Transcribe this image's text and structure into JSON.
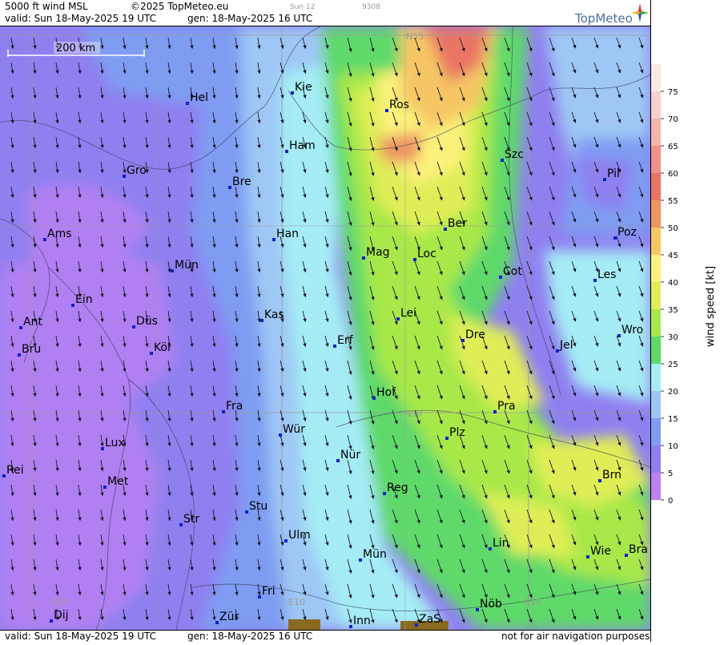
{
  "header": {
    "product": "5000 ft wind MSL",
    "copyright": "©2025 TopMeteo.eu",
    "valid": "valid:  Sun  18-May-2025  19 UTC",
    "gen": "gen: 18-May-2025 16 UTC",
    "run_tag": "Sun 12",
    "run_code": "9308",
    "logo_text": "TopMeteo"
  },
  "footer": {
    "valid": "valid:  Sun  18-May-2025  19 UTC",
    "gen": "gen: 18-May-2025 16 UTC",
    "disclaimer": "not for air navigation purposes"
  },
  "map": {
    "scale_label": "200 km",
    "grid_labels": [
      "N55",
      "N50",
      "E05",
      "E10",
      "E15"
    ],
    "cities": [
      {
        "name": "Kie"
      },
      {
        "name": "Hel"
      },
      {
        "name": "Ros"
      },
      {
        "name": "Ham"
      },
      {
        "name": "Gro"
      },
      {
        "name": "Bre"
      },
      {
        "name": "Szc"
      },
      {
        "name": "Pil"
      },
      {
        "name": "Ber"
      },
      {
        "name": "Ams"
      },
      {
        "name": "Han"
      },
      {
        "name": "Poz"
      },
      {
        "name": "Mag"
      },
      {
        "name": "Loc"
      },
      {
        "name": "Mün"
      },
      {
        "name": "Cot"
      },
      {
        "name": "Les"
      },
      {
        "name": "Ein"
      },
      {
        "name": "Kas"
      },
      {
        "name": "Lei"
      },
      {
        "name": "Ant"
      },
      {
        "name": "Düs"
      },
      {
        "name": "Wro"
      },
      {
        "name": "Dre"
      },
      {
        "name": "Erf"
      },
      {
        "name": "Bru"
      },
      {
        "name": "Köl"
      },
      {
        "name": "Jel"
      },
      {
        "name": "Hof"
      },
      {
        "name": "Fra"
      },
      {
        "name": "Pra"
      },
      {
        "name": "Wür"
      },
      {
        "name": "Plz"
      },
      {
        "name": "Lux"
      },
      {
        "name": "Nür"
      },
      {
        "name": "Rei"
      },
      {
        "name": "Brn"
      },
      {
        "name": "Met"
      },
      {
        "name": "Reg"
      },
      {
        "name": "Stu"
      },
      {
        "name": "Str"
      },
      {
        "name": "Ulm"
      },
      {
        "name": "Lin"
      },
      {
        "name": "Wie"
      },
      {
        "name": "Bra"
      },
      {
        "name": "Mün"
      },
      {
        "name": "Fri"
      },
      {
        "name": "Nöb"
      },
      {
        "name": "Dij"
      },
      {
        "name": "Zür"
      },
      {
        "name": "Inn"
      },
      {
        "name": "ZaS"
      }
    ]
  },
  "legend": {
    "title": "wind speed [kt]",
    "ticks": [
      "0",
      "5",
      "10",
      "15",
      "20",
      "25",
      "30",
      "35",
      "40",
      "45",
      "50",
      "55",
      "60",
      "65",
      "70",
      "75"
    ],
    "colors": [
      "#bf80f2",
      "#8f80f0",
      "#7e9df2",
      "#9ec7f5",
      "#a5ecf5",
      "#5fd96a",
      "#a8e84a",
      "#dfee57",
      "#fbf27c",
      "#f6c665",
      "#ee9560",
      "#ea7463",
      "#f0918b",
      "#f4b4ae",
      "#f8d1cd",
      "#fbe8e6"
    ]
  }
}
